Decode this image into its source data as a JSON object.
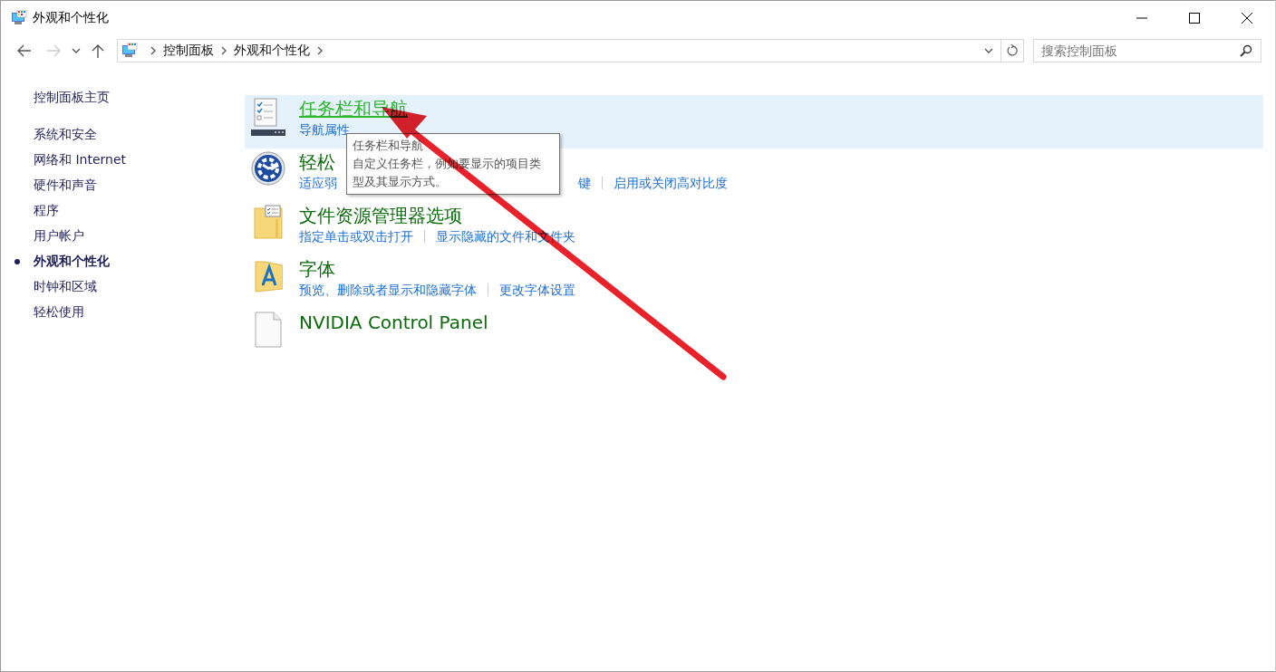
{
  "window": {
    "title": "外观和个性化"
  },
  "address_bar": {
    "crumbs": [
      "控制面板",
      "外观和个性化"
    ]
  },
  "search": {
    "placeholder": "搜索控制面板"
  },
  "sidebar": {
    "home": "控制面板主页",
    "items": [
      {
        "label": "系统和安全",
        "selected": false
      },
      {
        "label": "网络和 Internet",
        "selected": false
      },
      {
        "label": "硬件和声音",
        "selected": false
      },
      {
        "label": "程序",
        "selected": false
      },
      {
        "label": "用户帐户",
        "selected": false
      },
      {
        "label": "外观和个性化",
        "selected": true
      },
      {
        "label": "时钟和区域",
        "selected": false
      },
      {
        "label": "轻松使用",
        "selected": false
      }
    ]
  },
  "categories": [
    {
      "kind": "taskbar",
      "title": "任务栏和导航",
      "hovered": true,
      "links": [
        "导航属性"
      ]
    },
    {
      "kind": "ease",
      "title": "轻松",
      "hovered": false,
      "links": [
        "适应弱",
        "键",
        "启用或关闭高对比度"
      ]
    },
    {
      "kind": "folder",
      "title": "文件资源管理器选项",
      "hovered": false,
      "links": [
        "指定单击或双击打开",
        "显示隐藏的文件和文件夹"
      ]
    },
    {
      "kind": "font",
      "title": "字体",
      "hovered": false,
      "links": [
        "预览、删除或者显示和隐藏字体",
        "更改字体设置"
      ]
    },
    {
      "kind": "blank",
      "title": "NVIDIA Control Panel",
      "hovered": false
    }
  ],
  "tooltip": {
    "title": "任务栏和导航",
    "text": "自定义任务栏，例如要显示的项目类型及其显示方式。"
  }
}
